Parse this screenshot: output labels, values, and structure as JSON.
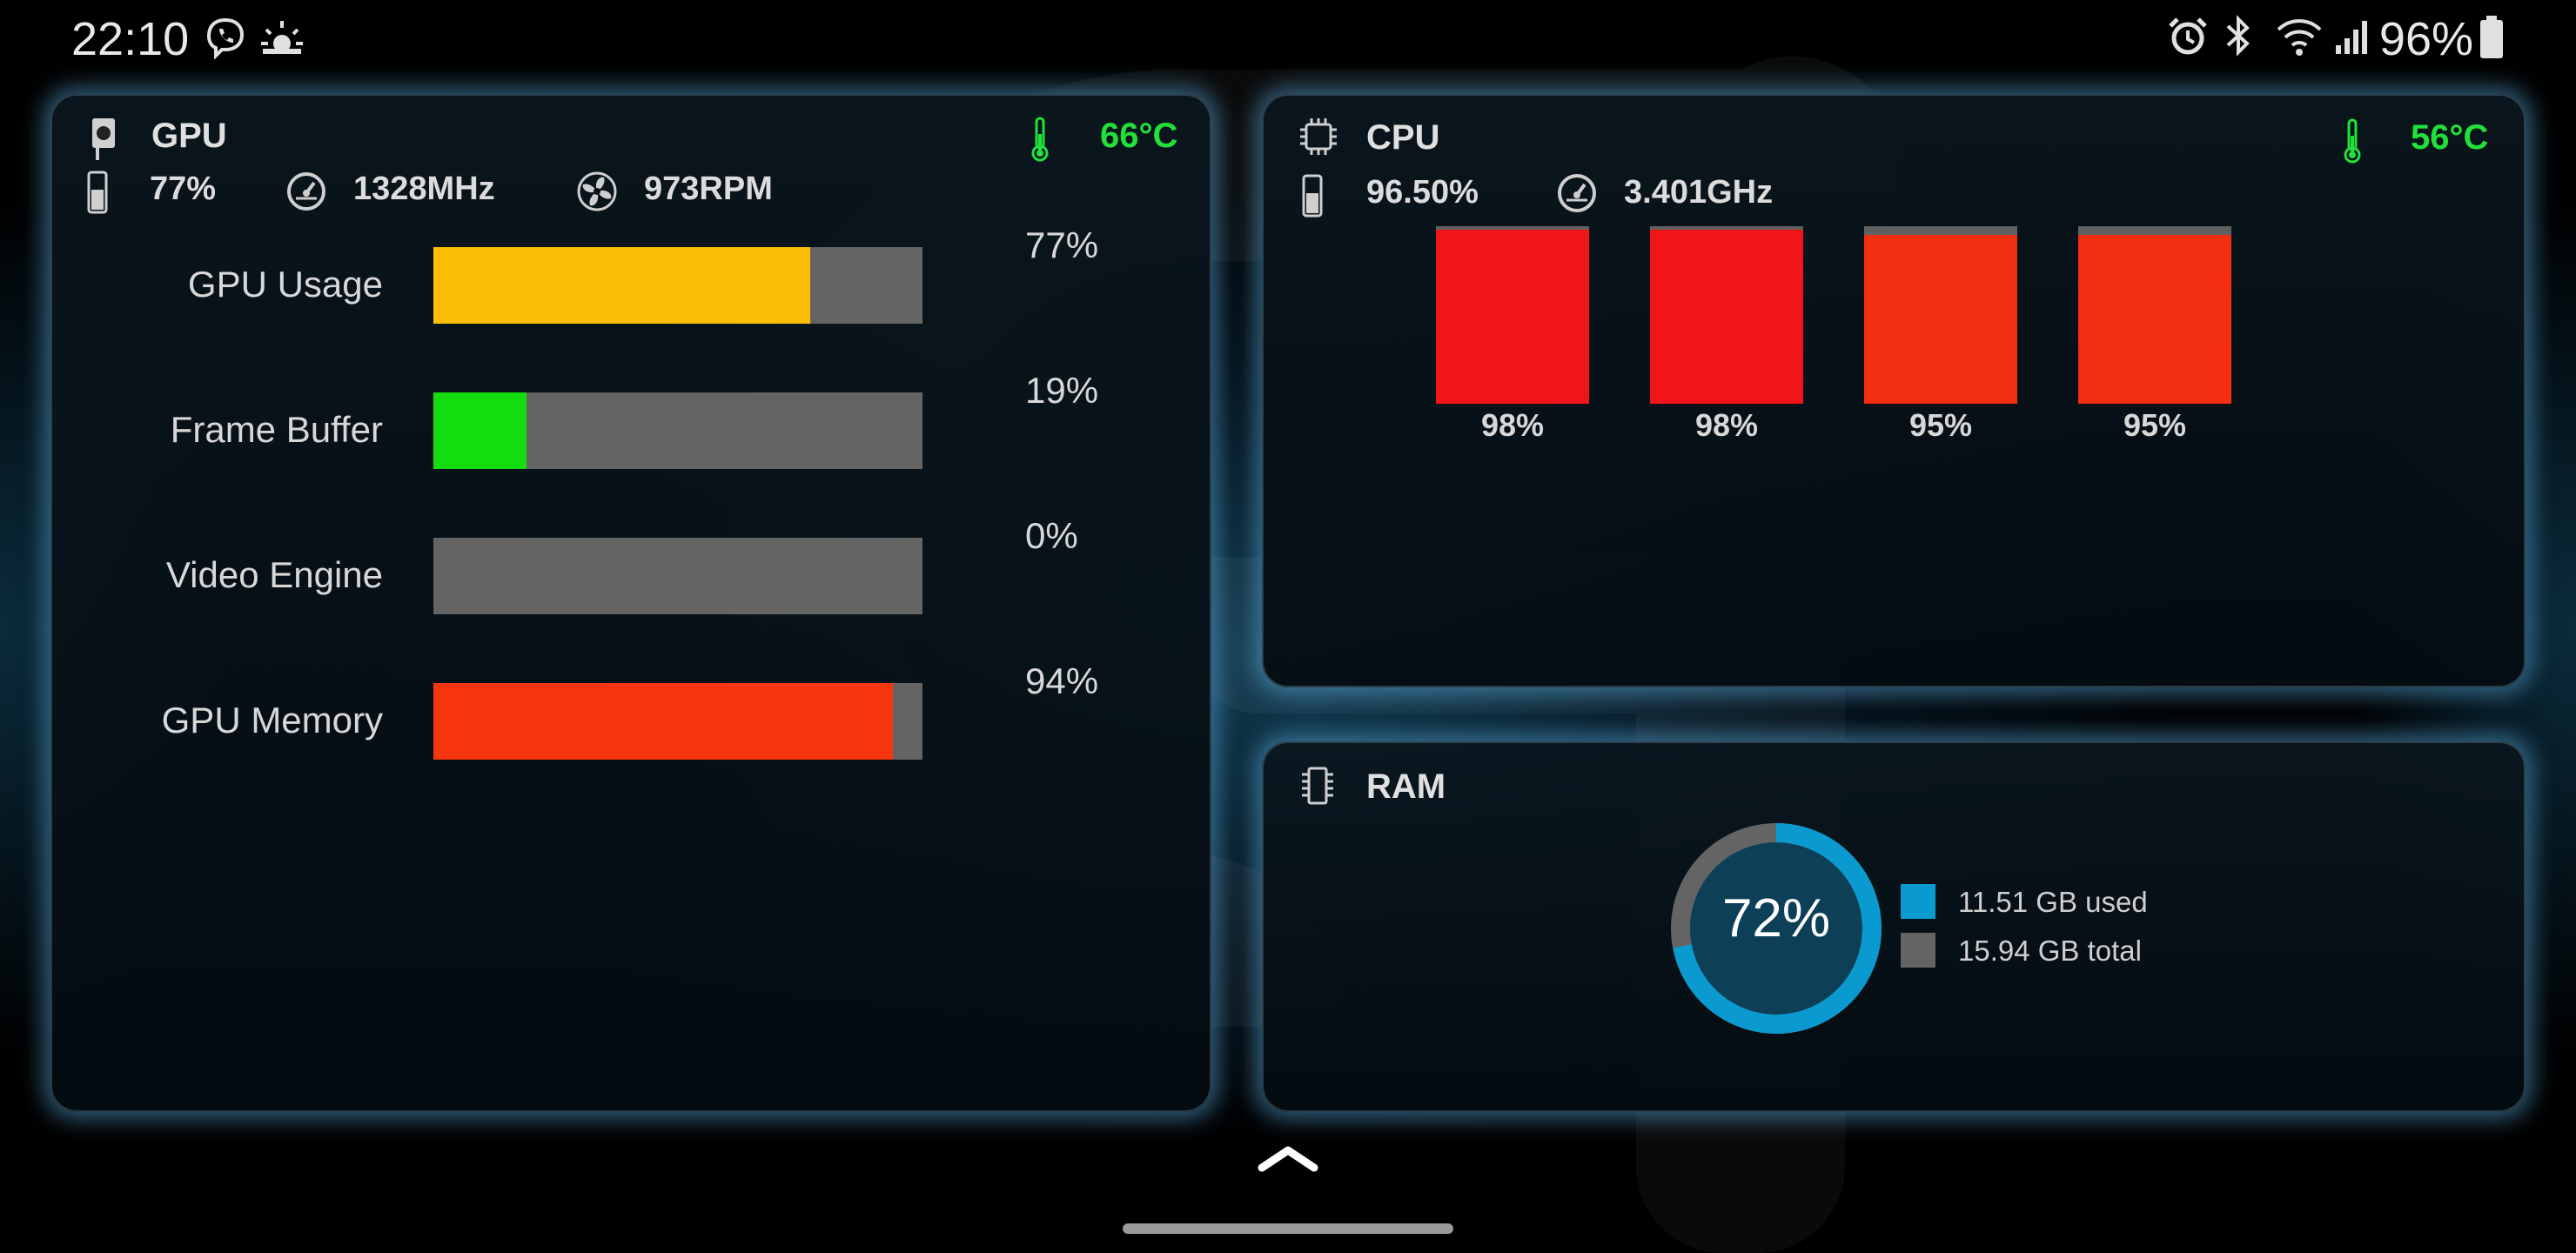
{
  "status_bar": {
    "time": "22:10",
    "left_icons": [
      "viber-icon",
      "weather-icon"
    ],
    "right_icons": [
      "alarm-icon",
      "bluetooth-icon",
      "wifi-icon",
      "signal-icon",
      "battery-icon"
    ],
    "battery": "96%"
  },
  "gpu": {
    "title": "GPU",
    "temperature": "66°C",
    "usage": "77%",
    "clock": "1328MHz",
    "fan": "973RPM",
    "bars": [
      {
        "label": "GPU Usage",
        "percent_text": "77%",
        "value": 77,
        "color": "#fcbf06"
      },
      {
        "label": "Frame Buffer",
        "percent_text": "19%",
        "value": 19,
        "color": "#13dd0e"
      },
      {
        "label": "Video Engine",
        "percent_text": "0%",
        "value": 0,
        "color": "#13dd0e"
      },
      {
        "label": "GPU Memory",
        "percent_text": "94%",
        "value": 94,
        "color": "#f6360e"
      }
    ]
  },
  "cpu": {
    "title": "CPU",
    "temperature": "56°C",
    "usage": "96.50%",
    "clock": "3.401GHz",
    "cores": [
      {
        "label": "98%",
        "value": 98,
        "color": "#f1151a"
      },
      {
        "label": "98%",
        "value": 98,
        "color": "#f1151a"
      },
      {
        "label": "95%",
        "value": 95,
        "color": "#f42e10"
      },
      {
        "label": "95%",
        "value": 95,
        "color": "#f42e10"
      }
    ]
  },
  "ram": {
    "title": "RAM",
    "percent_text": "72%",
    "value": 72,
    "used_label": "11.51 GB used",
    "total_label": "15.94 GB total",
    "used_color": "#0a9ad0",
    "total_color": "#646464"
  },
  "colors": {
    "temp_green": "#22e03a"
  }
}
